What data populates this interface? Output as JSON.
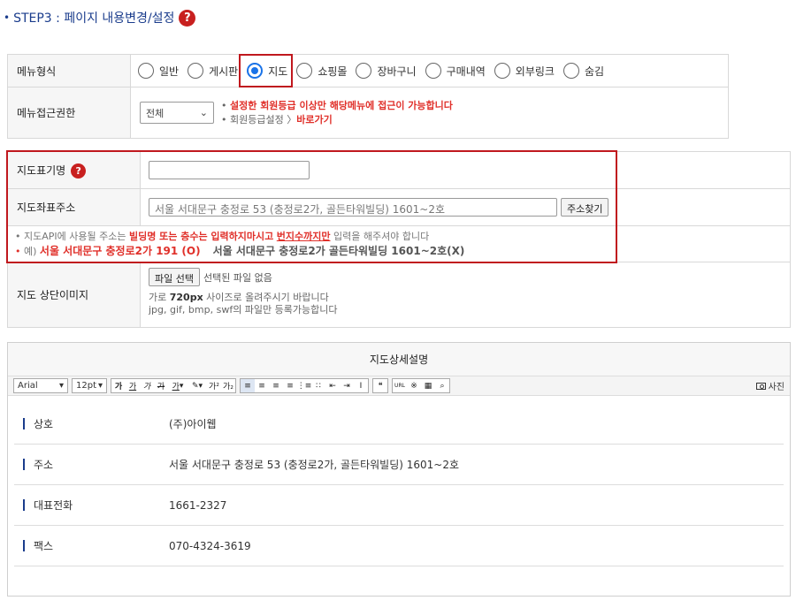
{
  "step": {
    "title": "STEP3 : 페이지 내용변경/설정",
    "help_icon": "question-icon"
  },
  "menu_type": {
    "label": "메뉴형식",
    "options": [
      "일반",
      "게시판",
      "지도",
      "쇼핑몰",
      "장바구니",
      "구매내역",
      "외부링크",
      "숨김"
    ],
    "selected": "지도"
  },
  "access": {
    "label": "메뉴접근권한",
    "select_value": "전체",
    "note_warning": "설정한 회원등급 이상만 해당메뉴에 접근이 가능합니다",
    "note_setting": "회원등급설정",
    "note_link": "바로가기"
  },
  "map_name": {
    "label": "지도표기명",
    "value": ""
  },
  "map_address": {
    "label": "지도좌표주소",
    "value": "서울 서대문구 충정로 53 (충정로2가, 골든타워빌딩) 1601~2호",
    "search_button": "주소찾기",
    "hint_prefix": "지도API에 사용될 주소는 ",
    "hint_red": "빌딩명 또는 층수는 입력하지마시고",
    "hint_underline": "번지수까지만",
    "hint_suffix": " 입력을 해주셔야 합니다",
    "example_prefix": "예)",
    "example_ok": "서울 서대문구 충정로2가 191 (O)",
    "example_bad": "서울 서대문구 충정로2가 골든타워빌딩 1601~2호(X)"
  },
  "map_image": {
    "label": "지도 상단이미지",
    "file_button": "파일 선택",
    "file_status": "선택된 파일 없음",
    "hint_line1_pre": "가로 ",
    "hint_line1_bold": "720px",
    "hint_line1_post": " 사이즈로 올려주시기 바랍니다",
    "hint_line2": "jpg, gif, bmp, swf의 파일만 등록가능합니다"
  },
  "editor": {
    "title": "지도상세설명",
    "font": "Arial",
    "size": "12pt",
    "photo_button": "사진",
    "rows": [
      {
        "key": "상호",
        "value": "(주)아이웹"
      },
      {
        "key": "주소",
        "value": "서울 서대문구 충정로 53 (충정로2가, 골든타워빌딩) 1601~2호"
      },
      {
        "key": "대표전화",
        "value": "1661-2327"
      },
      {
        "key": "팩스",
        "value": "070-4324-3619"
      }
    ]
  },
  "colors": {
    "accent_red": "#c8201f",
    "brand_blue": "#1a3c8c",
    "radio_blue": "#1a73e8"
  }
}
